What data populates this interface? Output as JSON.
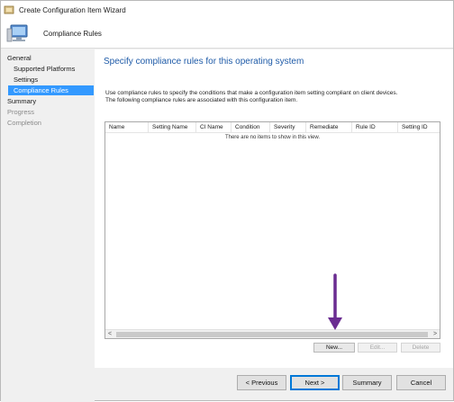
{
  "window": {
    "title": "Create Configuration Item Wizard"
  },
  "header": {
    "title": "Compliance Rules"
  },
  "nav": {
    "items": [
      {
        "label": "General",
        "state": "normal"
      },
      {
        "label": "Supported Platforms",
        "state": "normal"
      },
      {
        "label": "Settings",
        "state": "normal"
      },
      {
        "label": "Compliance Rules",
        "state": "selected"
      },
      {
        "label": "Summary",
        "state": "normal"
      },
      {
        "label": "Progress",
        "state": "disabled"
      },
      {
        "label": "Completion",
        "state": "disabled"
      }
    ]
  },
  "main": {
    "heading": "Specify compliance rules for this operating system",
    "description_line1": "Use compliance rules to specify the conditions that make a configuration item setting compliant on client devices.",
    "description_line2": "The following compliance rules are associated with this configuration item.",
    "columns": [
      "Name",
      "Setting Name",
      "CI Name",
      "Condition",
      "Severity",
      "Remediate",
      "Rule ID",
      "Setting ID"
    ],
    "empty_text": "There are no items to show in this view.",
    "scroll_left": "<",
    "scroll_right": ">",
    "buttons": {
      "new": "New...",
      "edit": "Edit...",
      "delete": "Delete"
    }
  },
  "footer": {
    "previous": "< Previous",
    "next": "Next >",
    "summary": "Summary",
    "cancel": "Cancel"
  },
  "colors": {
    "accent": "#1f5ba8",
    "selection": "#3399ff",
    "annotation_arrow": "#6a2c91"
  }
}
